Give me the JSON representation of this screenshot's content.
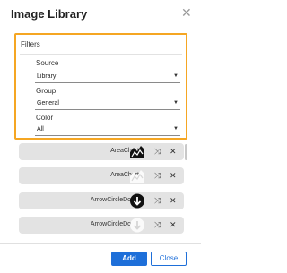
{
  "dialog": {
    "title": "Image Library",
    "close_symbol": "✕"
  },
  "filters": {
    "legend": "Filters",
    "source": {
      "label": "Source",
      "value": "Library"
    },
    "group": {
      "label": "Group",
      "value": "General"
    },
    "color": {
      "label": "Color",
      "value": "All"
    }
  },
  "items": [
    {
      "name": "AreaChart",
      "icon": "area-chart-icon",
      "variant": "black"
    },
    {
      "name": "AreaChart",
      "icon": "area-chart-icon",
      "variant": "white"
    },
    {
      "name": "ArrowCircleDown",
      "icon": "arrow-circle-down-icon",
      "variant": "black"
    },
    {
      "name": "ArrowCircleDown",
      "icon": "arrow-circle-down-icon",
      "variant": "white"
    }
  ],
  "row_actions": {
    "shuffle_symbol": "⤨",
    "remove_symbol": "✕"
  },
  "footer": {
    "add_label": "Add",
    "close_label": "Close"
  },
  "colors": {
    "accent": "#1e6fd9",
    "highlight": "#f5a623",
    "row_bg": "#e3e3e3"
  }
}
